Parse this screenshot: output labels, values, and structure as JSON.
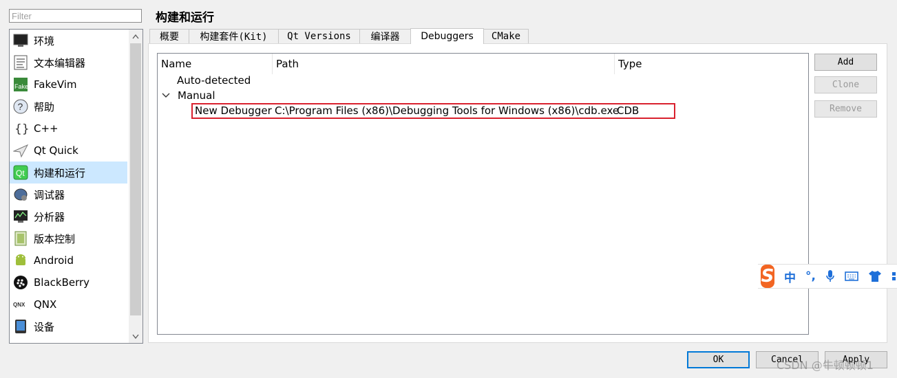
{
  "filter": {
    "placeholder": "Filter"
  },
  "sidebar": {
    "items": [
      {
        "label": "环境",
        "icon": "monitor-icon"
      },
      {
        "label": "文本编辑器",
        "icon": "text-editor-icon"
      },
      {
        "label": "FakeVim",
        "icon": "fakevim-icon"
      },
      {
        "label": "帮助",
        "icon": "help-icon"
      },
      {
        "label": "C++",
        "icon": "braces-icon"
      },
      {
        "label": "Qt Quick",
        "icon": "paper-plane-icon"
      },
      {
        "label": "构建和运行",
        "icon": "build-run-icon"
      },
      {
        "label": "调试器",
        "icon": "debugger-icon"
      },
      {
        "label": "分析器",
        "icon": "analyzer-icon"
      },
      {
        "label": "版本控制",
        "icon": "version-control-icon"
      },
      {
        "label": "Android",
        "icon": "android-icon"
      },
      {
        "label": "BlackBerry",
        "icon": "blackberry-icon"
      },
      {
        "label": "QNX",
        "icon": "qnx-icon"
      },
      {
        "label": "设备",
        "icon": "device-icon"
      }
    ],
    "selected": "构建和运行"
  },
  "page_title": "构建和运行",
  "tabs": [
    {
      "label": "概要"
    },
    {
      "label": "构建套件(Kit)"
    },
    {
      "label": "Qt Versions"
    },
    {
      "label": "编译器"
    },
    {
      "label": "Debuggers"
    },
    {
      "label": "CMake"
    }
  ],
  "active_tab": "Debuggers",
  "tree": {
    "columns": [
      "Name",
      "Path",
      "Type"
    ],
    "groups": {
      "auto": "Auto-detected",
      "manual": "Manual"
    },
    "rows": [
      {
        "name": "New Debugger",
        "path": "C:\\Program Files (x86)\\Debugging Tools for Windows (x86)\\cdb.exe",
        "type": "CDB"
      }
    ]
  },
  "buttons": {
    "add": "Add",
    "clone": "Clone",
    "remove": "Remove",
    "ok": "OK",
    "cancel": "Cancel",
    "apply": "Apply"
  },
  "ime": {
    "logo": "S",
    "mode": "中",
    "punct": "°,"
  },
  "watermark": "CSDN @牛顿顿顿1"
}
